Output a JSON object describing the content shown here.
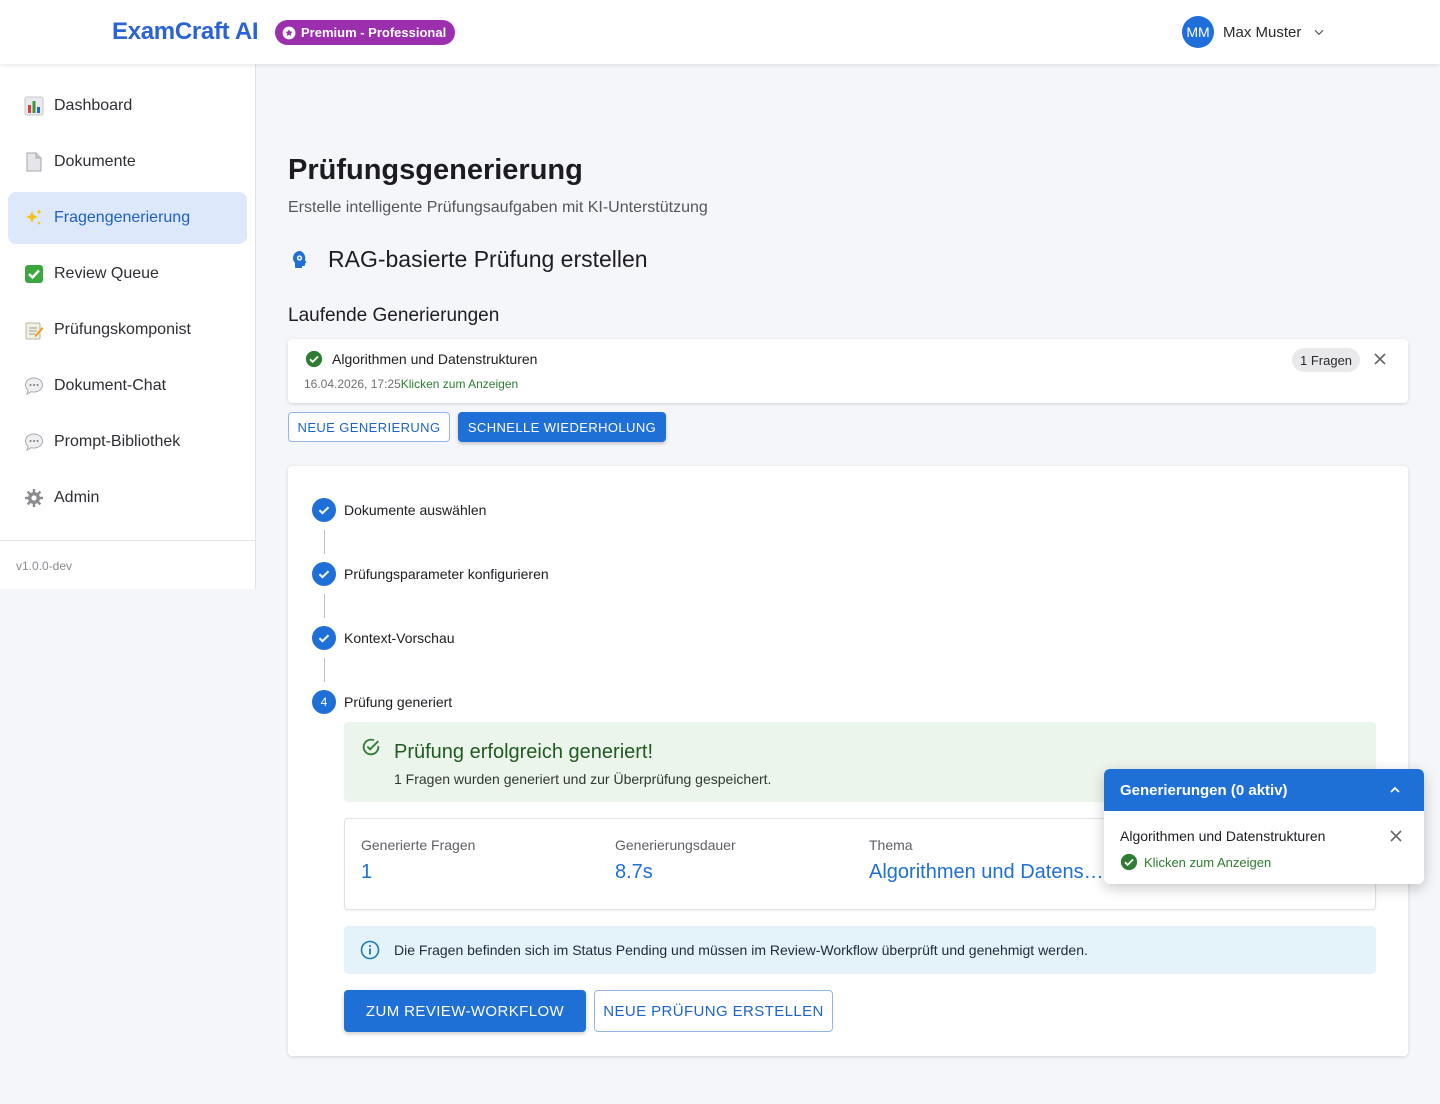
{
  "header": {
    "brand": "ExamCraft AI",
    "plan_badge": "Premium - Professional",
    "user_initials": "MM",
    "user_name": "Max Muster"
  },
  "sidebar": {
    "items": [
      {
        "label": "Dashboard",
        "icon": "bar-chart-icon"
      },
      {
        "label": "Dokumente",
        "icon": "document-icon"
      },
      {
        "label": "Fragengenerierung",
        "icon": "sparkles-icon",
        "active": true
      },
      {
        "label": "Review Queue",
        "icon": "check-box-icon"
      },
      {
        "label": "Prüfungskomponist",
        "icon": "memo-icon"
      },
      {
        "label": "Dokument-Chat",
        "icon": "speech-bubble-icon"
      },
      {
        "label": "Prompt-Bibliothek",
        "icon": "speech-bubble-icon"
      },
      {
        "label": "Admin",
        "icon": "gear-icon"
      }
    ],
    "version": "v1.0.0-dev"
  },
  "page": {
    "title": "Prüfungsgenerierung",
    "subtitle": "Erstelle intelligente Prüfungsaufgaben mit KI-Unterstützung",
    "section_title": "RAG-basierte Prüfung erstellen",
    "running_title": "Laufende Generierungen"
  },
  "running": {
    "title": "Algorithmen und Datenstrukturen",
    "timestamp": "16.04.2026, 17:25",
    "link": "Klicken zum Anzeigen",
    "count_chip": "1 Fragen"
  },
  "actions": {
    "new_generation": "NEUE GENERIERUNG",
    "quick_repeat": "SCHNELLE WIEDERHOLUNG"
  },
  "stepper": {
    "steps": [
      {
        "label": "Dokumente auswählen",
        "state": "done"
      },
      {
        "label": "Prüfungsparameter konfigurieren",
        "state": "done"
      },
      {
        "label": "Kontext-Vorschau",
        "state": "done"
      },
      {
        "label": "Prüfung generiert",
        "state": "active",
        "number": "4"
      }
    ]
  },
  "result": {
    "success_title": "Prüfung erfolgreich generiert!",
    "success_sub": "1 Fragen wurden generiert und zur Überprüfung gespeichert.",
    "stats": [
      {
        "label": "Generierte Fragen",
        "value": "1"
      },
      {
        "label": "Generierungsdauer",
        "value": "8.7s"
      },
      {
        "label": "Thema",
        "value": "Algorithmen und Datenstrukturen"
      }
    ],
    "info": "Die Fragen befinden sich im Status Pending und müssen im Review-Workflow überprüft und genehmigt werden.",
    "primary_button": "ZUM REVIEW-WORKFLOW",
    "secondary_button": "NEUE PRÜFUNG ERSTELLEN"
  },
  "floating": {
    "header": "Generierungen (0 aktiv)",
    "item_title": "Algorithmen und Datenstrukturen",
    "item_link": "Klicken zum Anzeigen"
  },
  "colors": {
    "primary": "#1e6fd6",
    "brand": "#2a63d4",
    "premium": "#9b2fae",
    "success": "#2e7d32",
    "success_bg": "#ecf5ec",
    "info_bg": "#e4f3fa",
    "active_nav_bg": "#dde9fb"
  }
}
